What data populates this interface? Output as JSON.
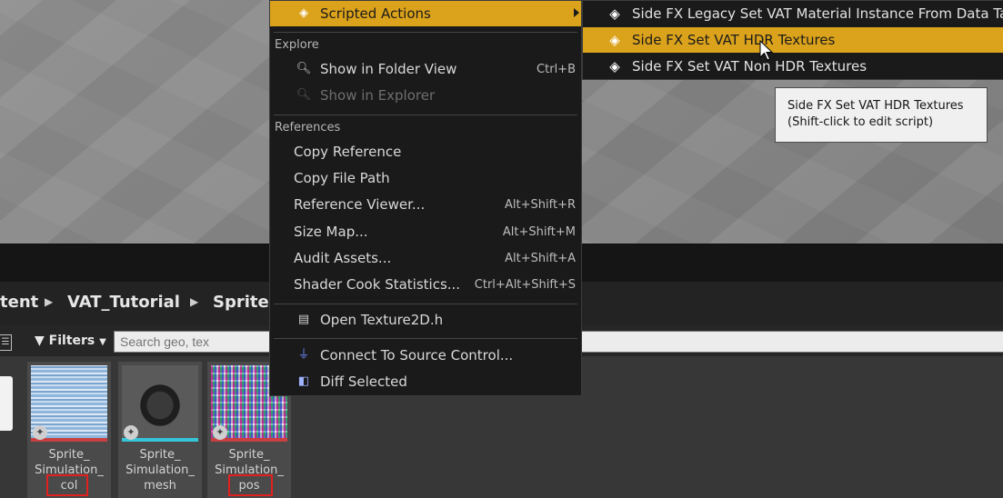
{
  "breadcrumb": {
    "items": [
      "tent",
      "VAT_Tutorial",
      "Sprite"
    ]
  },
  "filters": {
    "label": "Filters",
    "list_icon": "list-view-icon",
    "search_placeholder": "Search geo, tex"
  },
  "assets": [
    {
      "line1": "Sprite_",
      "line2": "Simulation_",
      "line3": "col",
      "type_color": "#c94040",
      "highlighted": true
    },
    {
      "line1": "Sprite_",
      "line2": "Simulation_",
      "line3": "mesh",
      "type_color": "#34c6d8",
      "highlighted": false
    },
    {
      "line1": "Sprite_",
      "line2": "Simulation_",
      "line3": "pos",
      "type_color": "#c94040",
      "highlighted": true
    }
  ],
  "menu": {
    "scripted_actions": "Scripted Actions",
    "sections": {
      "explore": "Explore",
      "references": "References"
    },
    "items": {
      "show_in_folder_view": {
        "label": "Show in Folder View",
        "shortcut": "Ctrl+B"
      },
      "show_in_explorer": {
        "label": "Show in Explorer"
      },
      "copy_reference": {
        "label": "Copy Reference"
      },
      "copy_file_path": {
        "label": "Copy File Path"
      },
      "reference_viewer": {
        "label": "Reference Viewer...",
        "shortcut": "Alt+Shift+R"
      },
      "size_map": {
        "label": "Size Map...",
        "shortcut": "Alt+Shift+M"
      },
      "audit_assets": {
        "label": "Audit Assets...",
        "shortcut": "Alt+Shift+A"
      },
      "shader_cook_statistics": {
        "label": "Shader Cook Statistics...",
        "shortcut": "Ctrl+Alt+Shift+S"
      },
      "open_texture2d_h": {
        "label": "Open Texture2D.h"
      },
      "connect_to_source_control": {
        "label": "Connect To Source Control..."
      },
      "diff_selected": {
        "label": "Diff Selected"
      }
    }
  },
  "submenu": {
    "items": [
      {
        "label": "Side FX Legacy Set VAT Material Instance From Data Tab",
        "highlighted": false
      },
      {
        "label": "Side FX Set VAT HDR Textures",
        "highlighted": true
      },
      {
        "label": "Side FX Set VAT Non HDR Textures",
        "highlighted": false
      }
    ]
  },
  "tooltip": {
    "line1": "Side FX Set VAT HDR Textures",
    "line2": "(Shift-click to edit script)"
  },
  "colors": {
    "highlight": "#dba21b",
    "menu_bg": "#1a1a1a",
    "annotation": "#e32020"
  }
}
